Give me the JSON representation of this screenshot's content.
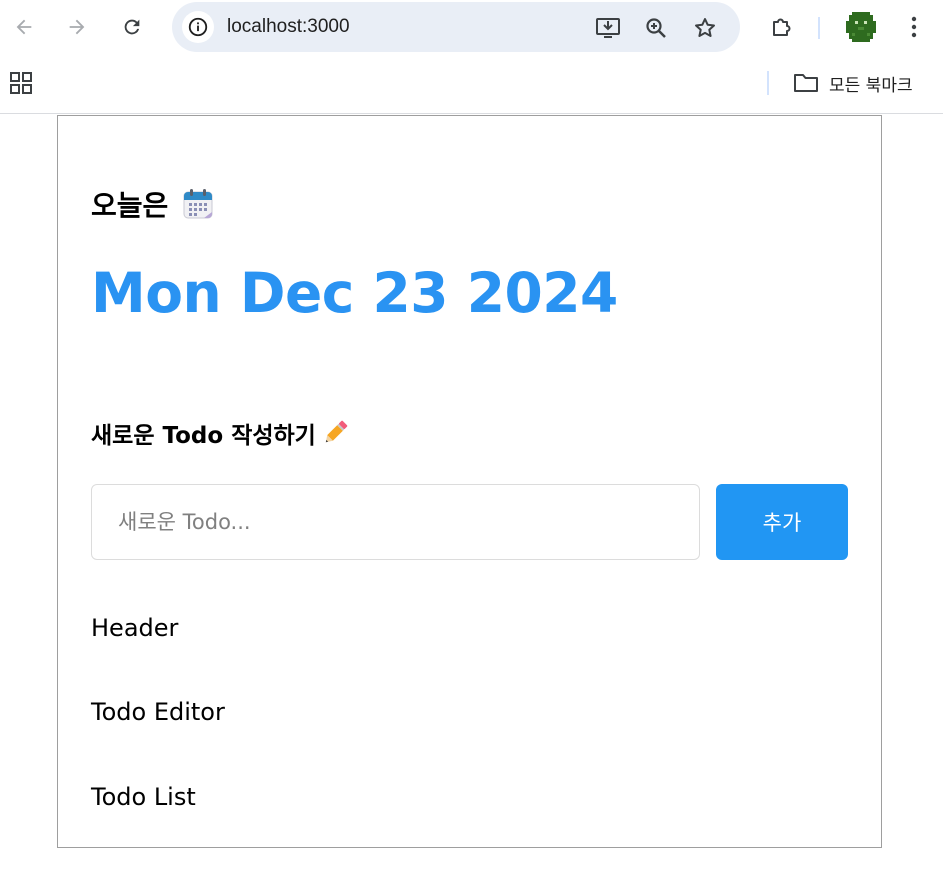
{
  "browser": {
    "url": "localhost:3000",
    "bookmarks": {
      "folder_label": "모든 북마크"
    }
  },
  "header": {
    "today_label": "오늘은",
    "date": "Mon Dec 23 2024"
  },
  "editor": {
    "title": "새로운 Todo 작성하기",
    "input_placeholder": "새로운 Todo...",
    "input_value": "",
    "add_button_label": "추가"
  },
  "sections": [
    "Header",
    "Todo Editor",
    "Todo List"
  ],
  "colors": {
    "date_blue": "#2a93f2",
    "button_blue": "#2196f3",
    "omnibox_bg": "#e9eef6"
  }
}
